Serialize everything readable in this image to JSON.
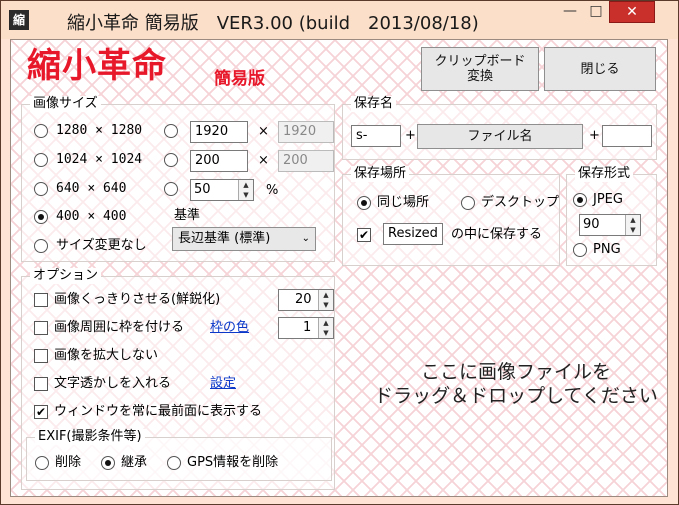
{
  "window": {
    "icon_char": "縮",
    "title": "縮小革命 簡易版　VER3.00 (build　2013/08/18)",
    "minimize_glyph": "—",
    "maximize_glyph": "□",
    "close_glyph": "✕"
  },
  "logo": {
    "main": "縮小革命",
    "sub": "簡易版"
  },
  "top_buttons": {
    "clipboard": "クリップボード\n変換",
    "close": "閉じる"
  },
  "image_size": {
    "label": "画像サイズ",
    "presets": [
      {
        "w": "1280",
        "x": "×",
        "h": "1280",
        "selected": false
      },
      {
        "w": "1024",
        "x": "×",
        "h": "1024",
        "selected": false
      },
      {
        "w": "640",
        "x": "×",
        "h": "640",
        "selected": false
      },
      {
        "w": "400",
        "x": "×",
        "h": "400",
        "selected": true
      }
    ],
    "no_resize": "サイズ変更なし",
    "custom1": {
      "w": "1920",
      "x": "×",
      "h": "1920"
    },
    "custom2": {
      "w": "200",
      "x": "×",
      "h": "200"
    },
    "percent": {
      "value": "50",
      "unit": "%"
    },
    "basis_label": "基準",
    "basis_value": "長辺基準 (標準)"
  },
  "save_name": {
    "label": "保存名",
    "prefix": "s-",
    "plus1": "+",
    "filename_button": "ファイル名",
    "plus2": "+",
    "suffix": ""
  },
  "save_location": {
    "label": "保存場所",
    "same_place": "同じ場所",
    "desktop": "デスクトップ",
    "folder_checked": true,
    "folder_name": "Resized",
    "folder_suffix": "の中に保存する"
  },
  "save_format": {
    "label": "保存形式",
    "jpeg": "JPEG",
    "quality": "90",
    "png": "PNG"
  },
  "options": {
    "label": "オプション",
    "sharpen": {
      "label": "画像くっきりさせる(鮮鋭化)",
      "value": "20"
    },
    "frame": {
      "label": "画像周囲に枠を付ける",
      "link": "枠の色",
      "value": "1"
    },
    "no_enlarge": "画像を拡大しない",
    "watermark": {
      "label": "文字透かしを入れる",
      "link": "設定"
    },
    "topmost": "ウィンドウを常に最前面に表示する",
    "check_mark": "✔"
  },
  "exif": {
    "label": "EXIF(撮影条件等)",
    "delete": "削除",
    "inherit": "継承",
    "gps_delete": "GPS情報を削除"
  },
  "dropzone": "ここに画像ファイルを\nドラッグ＆ドロップしてください",
  "spin_up": "▲",
  "spin_down": "▼",
  "dropdown_arrow": "⌄"
}
